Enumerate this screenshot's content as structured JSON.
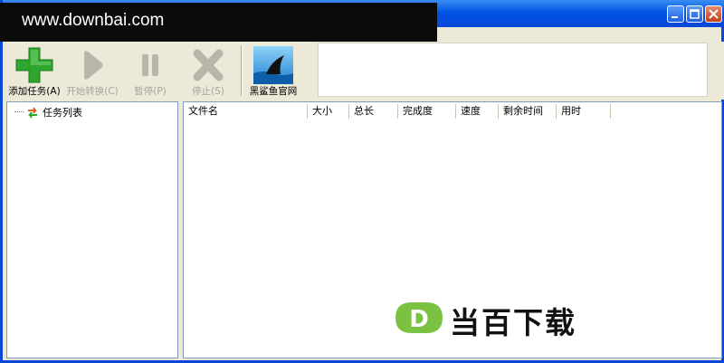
{
  "watermark": "www.downbai.com",
  "toolbar": {
    "add_task": "添加任务(A)",
    "start_convert": "开始转换(C)",
    "pause": "暂停(P)",
    "stop": "停止(S)",
    "website": "黑鲨鱼官网"
  },
  "tree": {
    "task_list": "任务列表"
  },
  "columns": [
    "文件名",
    "大小",
    "总长",
    "完成度",
    "速度",
    "剩余时间",
    "用时"
  ],
  "logo": {
    "text": "当百下载",
    "letter": "D"
  },
  "colors": {
    "add_green": "#2ea52e",
    "disabled_gray": "#b8b6aa",
    "logo_green": "#7cc242",
    "title_blue": "#0054e3"
  },
  "icons": {
    "add": "plus-icon",
    "start": "play-icon",
    "pause": "pause-icon",
    "stop": "x-icon",
    "website": "shark-fin-icon"
  }
}
